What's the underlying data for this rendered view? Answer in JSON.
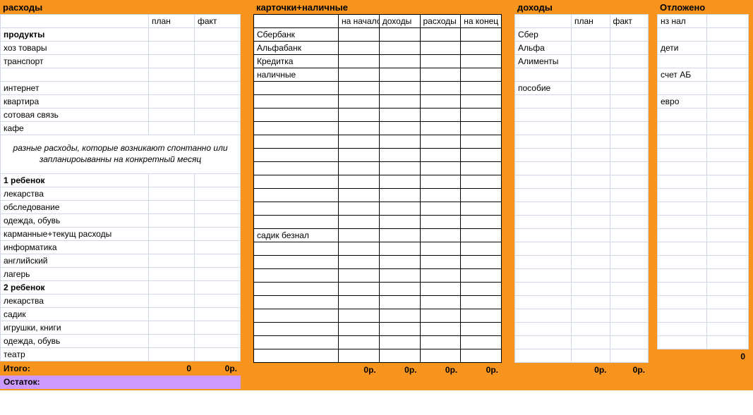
{
  "accent": "#f7941d",
  "ostatok_color": "#cc99ff",
  "expenses": {
    "title": "расходы",
    "plan_header": "план",
    "fact_header": "факт",
    "rows": [
      {
        "label": "продукты",
        "bold": true
      },
      {
        "label": "хоз товары"
      },
      {
        "label": "транспорт"
      },
      {
        "label": ""
      },
      {
        "label": "интернет"
      },
      {
        "label": "квартира"
      },
      {
        "label": "сотовая связь"
      },
      {
        "label": "кафе"
      },
      {
        "note": "разные расходы, которые возникают спонтанно или запланироыванны на конкретный месяц"
      },
      {
        "label": "1 ребенок",
        "bold": true
      },
      {
        "label": "лекарства"
      },
      {
        "label": "обследование"
      },
      {
        "label": "одежда, обувь"
      },
      {
        "label": "карманные+текущ расходы"
      },
      {
        "label": "информатика"
      },
      {
        "label": "английский"
      },
      {
        "label": "лагерь"
      },
      {
        "label": "2 ребенок",
        "bold": true
      },
      {
        "label": "лекарства"
      },
      {
        "label": "садик"
      },
      {
        "label": "игрушки, книги"
      },
      {
        "label": "одежда, обувь"
      },
      {
        "label": "театр"
      }
    ],
    "totals_label": "Итого:",
    "totals_plan": "0",
    "totals_fact": "0р.",
    "ostatok_label": "Остаток:"
  },
  "cards": {
    "title": "карточки+наличные",
    "headers": [
      "",
      "на начало",
      "доходы",
      "расходы",
      "на конец"
    ],
    "rows": [
      "Сбербанк",
      "Альфабанк",
      "Кредитка",
      "наличные",
      "",
      "",
      "",
      "",
      "",
      "",
      "",
      "",
      "",
      "",
      "",
      "садик безнал",
      "",
      "",
      "",
      "",
      "",
      "",
      "",
      "",
      ""
    ],
    "totals": [
      "",
      "0р.",
      "0р.",
      "0р.",
      "0р."
    ]
  },
  "income": {
    "title": "доходы",
    "plan_header": "план",
    "fact_header": "факт",
    "rows": [
      "Сбер",
      "Альфа",
      "Алименты",
      "",
      "пособие",
      "",
      "",
      "",
      "",
      "",
      "",
      "",
      "",
      "",
      "",
      "",
      "",
      "",
      "",
      "",
      "",
      "",
      "",
      "",
      ""
    ],
    "totals": [
      "",
      "0р.",
      "0р."
    ]
  },
  "savings": {
    "title": "Отложено",
    "rows": [
      {
        "label": "нз нал"
      },
      {
        "label": ""
      },
      {
        "label": "дети"
      },
      {
        "label": ""
      },
      {
        "label": "счет АБ"
      },
      {
        "label": ""
      },
      {
        "label": "евро"
      },
      {
        "label": ""
      },
      {
        "label": ""
      },
      {
        "label": ""
      },
      {
        "label": ""
      },
      {
        "label": ""
      },
      {
        "label": ""
      },
      {
        "label": ""
      },
      {
        "label": ""
      },
      {
        "label": ""
      },
      {
        "label": ""
      },
      {
        "label": ""
      },
      {
        "label": ""
      },
      {
        "label": ""
      },
      {
        "label": ""
      },
      {
        "label": ""
      },
      {
        "label": ""
      },
      {
        "label": ""
      },
      {
        "label": ""
      }
    ],
    "totals": [
      "",
      "0"
    ]
  }
}
